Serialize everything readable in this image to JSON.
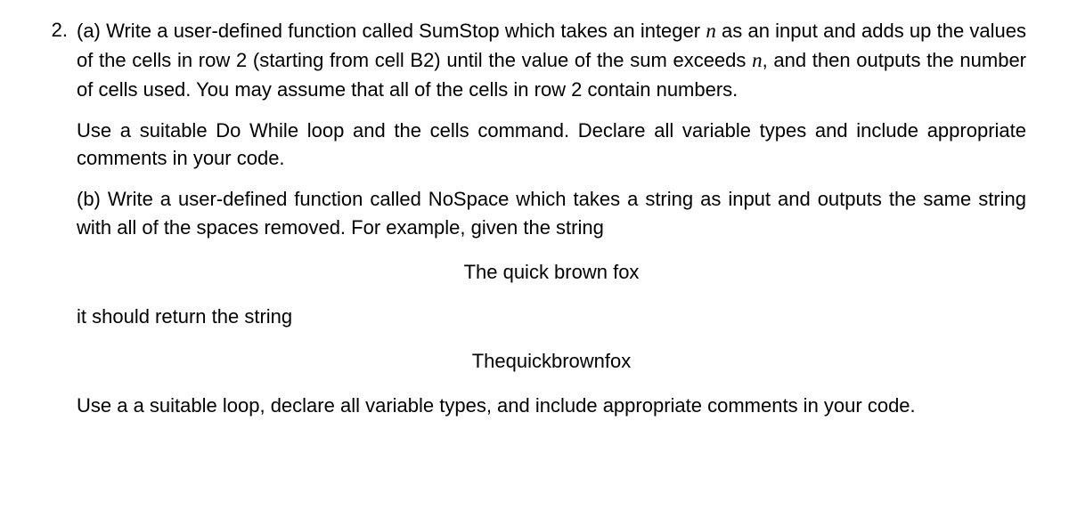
{
  "question": {
    "number": "2.",
    "partA": {
      "label": "(a)",
      "text1a": "Write a user-defined function called SumStop which takes an integer ",
      "var1": "n",
      "text1b": " as an input and adds up the values of the cells in row 2 (starting from cell B2) until the value of the sum exceeds ",
      "var2": "n",
      "text1c": ", and then outputs the number of cells used. You may assume that all of the cells in row 2 contain numbers.",
      "text2": "Use a suitable Do While loop and the cells command. Declare all variable types and include appropriate comments in your code."
    },
    "partB": {
      "label": "(b)",
      "text1": "Write a user-defined function called NoSpace which takes a string as input and outputs the same string with all of the spaces removed. For example, given the string",
      "example1": "The quick brown fox",
      "text2": "it should return the string",
      "example2": "Thequickbrownfox",
      "text3": "Use a a suitable loop, declare all variable types, and include appropriate comments in your code."
    }
  }
}
